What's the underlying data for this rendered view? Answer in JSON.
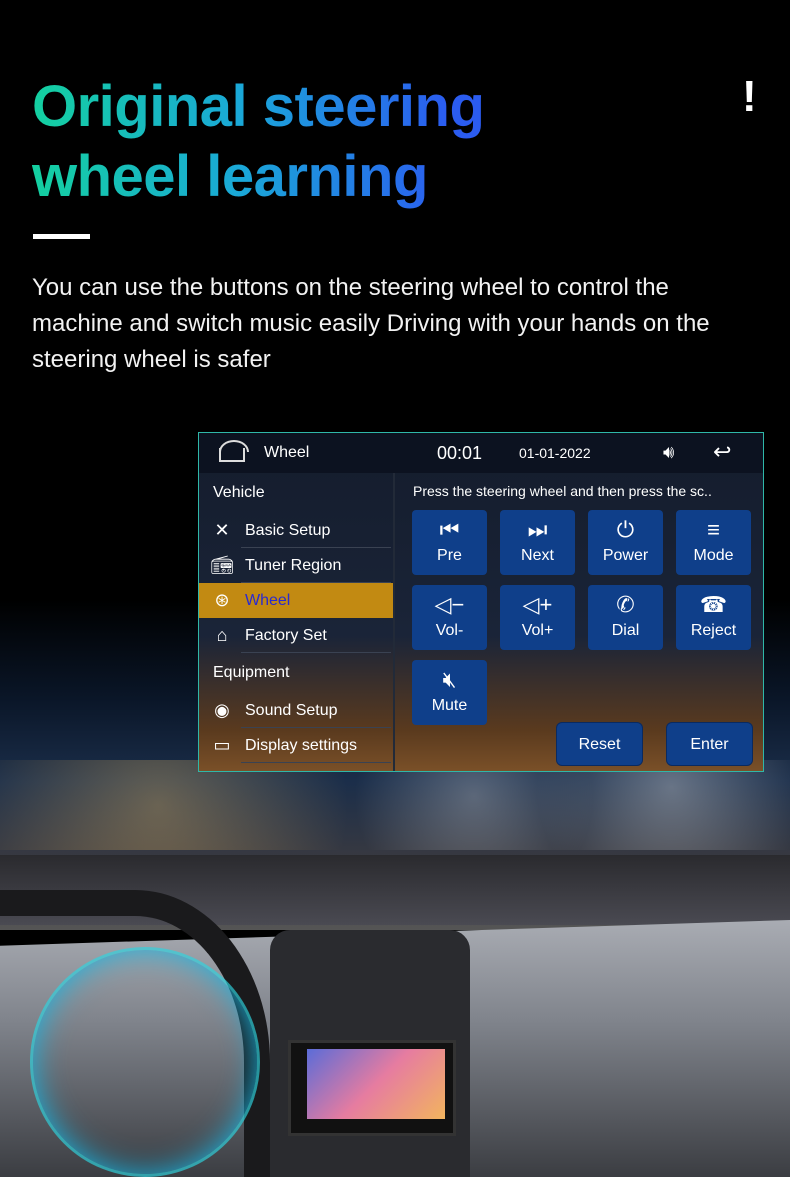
{
  "headline": {
    "title": "Original steering wheel learning",
    "exclamation": "!",
    "description": "You can use the buttons on the steering wheel to control the machine and switch music easily Driving with your hands on the steering wheel is safer"
  },
  "screen": {
    "header": {
      "title": "Wheel",
      "time": "00:01",
      "date": "01-01-2022",
      "home_icon": "home-icon",
      "volume_icon": "speaker-icon",
      "back_icon": "back-arrow-icon"
    },
    "sidebar": {
      "section1": "Vehicle",
      "items1": [
        {
          "label": "Basic Setup",
          "icon": "tools-icon"
        },
        {
          "label": "Tuner Region",
          "icon": "radio-icon"
        },
        {
          "label": "Wheel",
          "icon": "steering-wheel-icon",
          "active": true
        },
        {
          "label": "Factory Set",
          "icon": "factory-icon"
        }
      ],
      "section2": "Equipment",
      "items2": [
        {
          "label": "Sound Setup",
          "icon": "speaker-icon"
        },
        {
          "label": "Display settings",
          "icon": "monitor-icon"
        }
      ]
    },
    "hint": "Press the steering wheel and then press the sc..",
    "buttons": [
      {
        "label": "Pre",
        "icon": "previous-icon"
      },
      {
        "label": "Next",
        "icon": "next-icon"
      },
      {
        "label": "Power",
        "icon": "power-icon"
      },
      {
        "label": "Mode",
        "icon": "menu-icon"
      },
      {
        "label": "Vol-",
        "icon": "volume-down-icon"
      },
      {
        "label": "Vol+",
        "icon": "volume-up-icon"
      },
      {
        "label": "Dial",
        "icon": "phone-icon"
      },
      {
        "label": "Reject",
        "icon": "hangup-icon"
      },
      {
        "label": "Mute",
        "icon": "mute-icon"
      }
    ],
    "reset": "Reset",
    "enter": "Enter",
    "active_color": "#c28a12",
    "button_color": "#0f3f8a"
  }
}
